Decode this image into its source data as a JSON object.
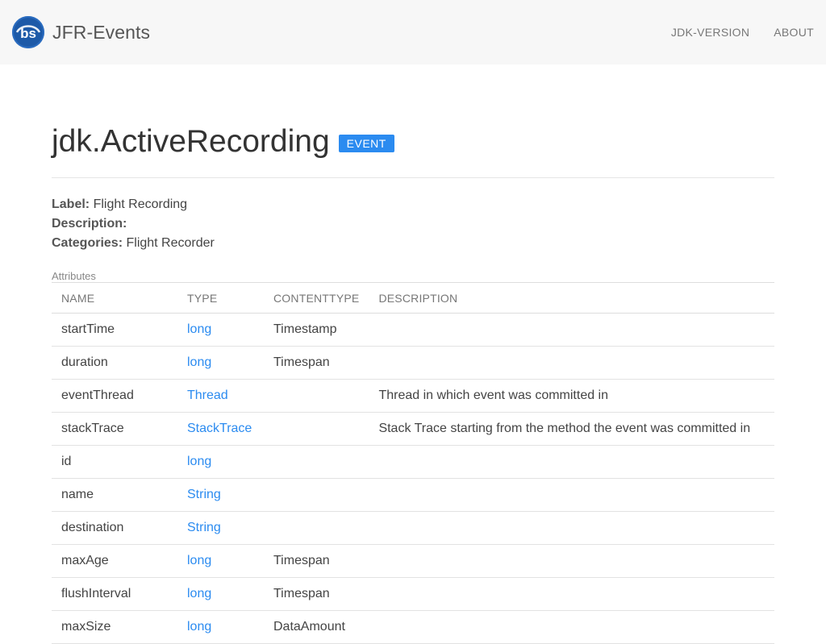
{
  "navbar": {
    "brand_logo_text": "bs",
    "brand_title": "JFR-Events",
    "links": [
      {
        "label": "JDK-VERSION"
      },
      {
        "label": "ABOUT"
      }
    ]
  },
  "header": {
    "title": "jdk.ActiveRecording",
    "badge": "EVENT"
  },
  "meta": {
    "label_key": "Label:",
    "label_value": "Flight Recording",
    "description_key": "Description:",
    "description_value": "",
    "categories_key": "Categories:",
    "categories_value": "Flight Recorder"
  },
  "attributes": {
    "caption": "Attributes",
    "columns": [
      "NAME",
      "TYPE",
      "CONTENTTYPE",
      "DESCRIPTION"
    ],
    "rows": [
      {
        "name": "startTime",
        "type": "long",
        "contenttype": "Timestamp",
        "description": ""
      },
      {
        "name": "duration",
        "type": "long",
        "contenttype": "Timespan",
        "description": ""
      },
      {
        "name": "eventThread",
        "type": "Thread",
        "contenttype": "",
        "description": "Thread in which event was committed in"
      },
      {
        "name": "stackTrace",
        "type": "StackTrace",
        "contenttype": "",
        "description": "Stack Trace starting from the method the event was committed in"
      },
      {
        "name": "id",
        "type": "long",
        "contenttype": "",
        "description": ""
      },
      {
        "name": "name",
        "type": "String",
        "contenttype": "",
        "description": ""
      },
      {
        "name": "destination",
        "type": "String",
        "contenttype": "",
        "description": ""
      },
      {
        "name": "maxAge",
        "type": "long",
        "contenttype": "Timespan",
        "description": ""
      },
      {
        "name": "flushInterval",
        "type": "long",
        "contenttype": "Timespan",
        "description": ""
      },
      {
        "name": "maxSize",
        "type": "long",
        "contenttype": "DataAmount",
        "description": ""
      }
    ]
  },
  "colors": {
    "navbar_bg": "#f7f7f7",
    "logo_bg": "#1d5aa8",
    "accent": "#2b8bf0",
    "badge_bg": "#2b8bf0"
  }
}
